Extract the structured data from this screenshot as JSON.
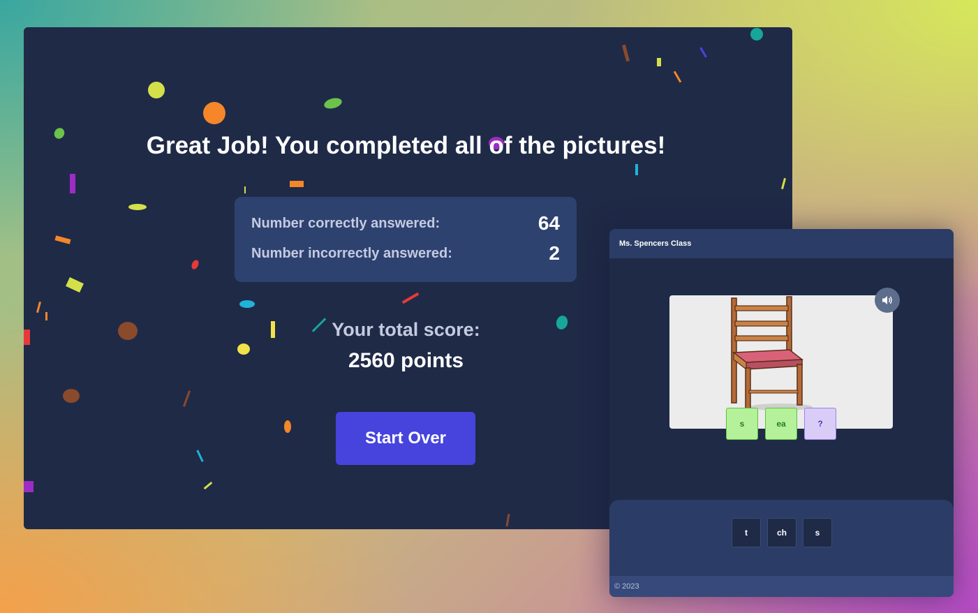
{
  "results": {
    "headline": "Great Job! You completed all of the pictures!",
    "stats": {
      "correct_label": "Number correctly answered:",
      "correct_value": "64",
      "incorrect_label": "Number incorrectly answered:",
      "incorrect_value": "2"
    },
    "score_label": "Your total score:",
    "score_value": "2560 points",
    "start_over_label": "Start Over"
  },
  "quiz": {
    "class_name": "Ms. Spencers Class",
    "picture_subject": "chair",
    "answer_tiles": [
      {
        "text": "s",
        "state": "correct"
      },
      {
        "text": "ea",
        "state": "correct"
      },
      {
        "text": "?",
        "state": "pending"
      }
    ],
    "choices": [
      "t",
      "ch",
      "s"
    ],
    "copyright": "© 2023"
  },
  "colors": {
    "panel_bg": "#1f2a47",
    "card_bg": "#2e4270",
    "primary_button": "#4644dc",
    "tile_correct": "#b4f19a",
    "tile_pending": "#d9cdf7"
  },
  "icons": {
    "sound": "speaker-icon"
  }
}
